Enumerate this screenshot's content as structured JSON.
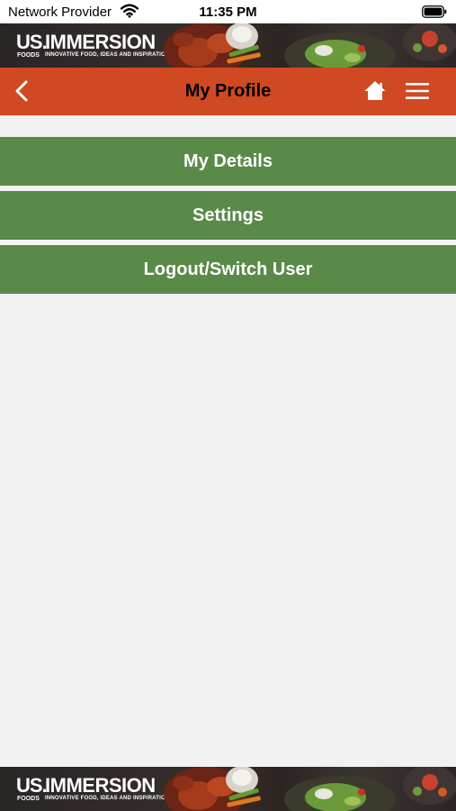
{
  "status": {
    "carrier": "Network Provider",
    "time": "11:35 PM"
  },
  "banner": {
    "brand_us": "US.",
    "brand_foods": "FOODS",
    "brand_name": "IMMERSION",
    "tagline": "INNOVATIVE FOOD, IDEAS AND INSPIRATION"
  },
  "header": {
    "title": "My Profile",
    "back_icon": "chevron-left-icon",
    "home_icon": "home-icon",
    "menu_icon": "hamburger-menu-icon"
  },
  "menu": {
    "items": [
      {
        "label": "My Details"
      },
      {
        "label": "Settings"
      },
      {
        "label": "Logout/Switch User"
      }
    ]
  },
  "colors": {
    "nav_bar": "#d14922",
    "menu_button": "#5a8a48",
    "background": "#f2f2f2"
  }
}
